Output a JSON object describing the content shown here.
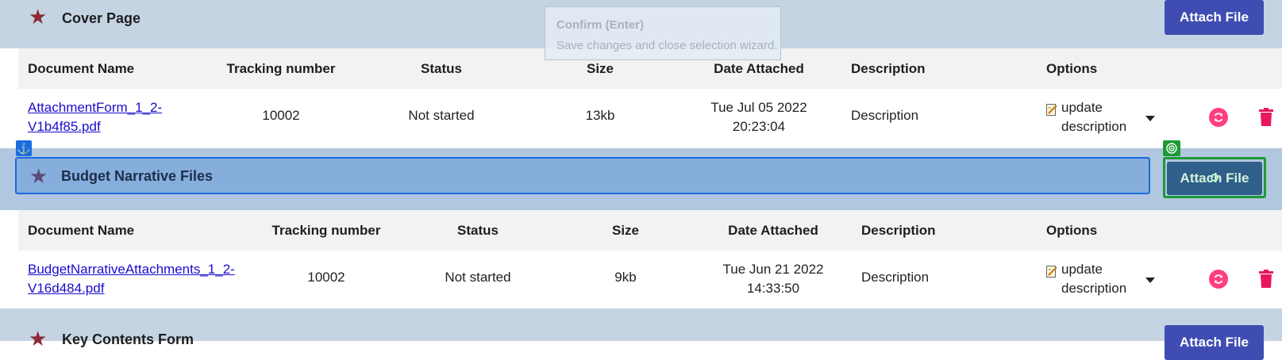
{
  "sections": {
    "cover": {
      "title": "Cover Page",
      "attach_label": "Attach File",
      "columns": [
        "Document Name",
        "Tracking number",
        "Status",
        "Size",
        "Date Attached",
        "Description",
        "Options"
      ],
      "row": {
        "doc_name_line1": "AttachmentForm_1_2-",
        "doc_name_line2": "V1b4f85.pdf",
        "tracking": "10002",
        "status": "Not started",
        "size": "13kb",
        "date_line1": "Tue Jul 05 2022",
        "date_line2": "20:23:04",
        "description": "Description",
        "option_line1": "update",
        "option_line2": "description"
      }
    },
    "budget": {
      "title": "Budget Narrative Files",
      "attach_label": "Attach File",
      "columns": [
        "Document Name",
        "Tracking number",
        "Status",
        "Size",
        "Date Attached",
        "Description",
        "Options"
      ],
      "row": {
        "doc_name_line1": "BudgetNarrativeAttachments_1_2-",
        "doc_name_line2": "V16d484.pdf",
        "tracking": "10002",
        "status": "Not started",
        "size": "9kb",
        "date_line1": "Tue Jun 21 2022",
        "date_line2": "14:33:50",
        "description": "Description",
        "option_line1": "update",
        "option_line2": "description"
      }
    },
    "key_contents": {
      "title": "Key Contents Form",
      "attach_label": "Attach File"
    }
  },
  "tooltip": {
    "title": "Confirm (Enter)",
    "body": "Save changes and close selection wizard."
  },
  "icons": {
    "section": "star-icon",
    "anchor": "anchor-icon",
    "target": "target-icon",
    "edit": "edit-note-icon",
    "dropdown": "caret-down-icon",
    "refresh": "refresh-icon",
    "delete": "trash-icon"
  },
  "colors": {
    "header_bg": "#c5d4e3",
    "attach_button": "#3f4db3",
    "star": "#8c2b35",
    "link": "#1a0dcc",
    "refresh": "#ff3d7f",
    "trash": "#e8185a",
    "selection_blue": "#1a6be0",
    "selection_green": "#1c9a35"
  }
}
